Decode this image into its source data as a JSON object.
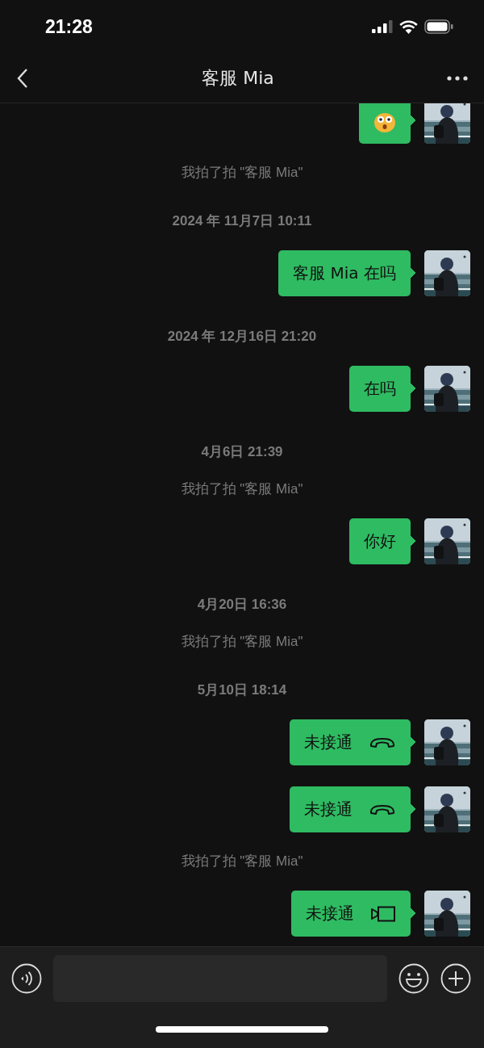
{
  "status_bar": {
    "time": "21:28"
  },
  "nav": {
    "title": "客服 Mia"
  },
  "messages": [
    {
      "kind": "sticker"
    },
    {
      "kind": "system",
      "text": "我拍了拍 \"客服 Mia\""
    },
    {
      "kind": "time",
      "text": "2024 年 11月7日 10:11"
    },
    {
      "kind": "text",
      "text": "客服 Mia 在吗"
    },
    {
      "kind": "time",
      "text": "2024 年 12月16日 21:20"
    },
    {
      "kind": "text",
      "text": "在吗"
    },
    {
      "kind": "time",
      "text": "4月6日 21:39"
    },
    {
      "kind": "system",
      "text": "我拍了拍 \"客服 Mia\""
    },
    {
      "kind": "text",
      "text": "你好"
    },
    {
      "kind": "time",
      "text": "4月20日 16:36"
    },
    {
      "kind": "system",
      "text": "我拍了拍 \"客服 Mia\""
    },
    {
      "kind": "time",
      "text": "5月10日 18:14"
    },
    {
      "kind": "voice_call",
      "text": "未接通"
    },
    {
      "kind": "voice_call",
      "text": "未接通"
    },
    {
      "kind": "system",
      "text": "我拍了拍 \"客服 Mia\""
    },
    {
      "kind": "video_call",
      "text": "未接通"
    }
  ]
}
